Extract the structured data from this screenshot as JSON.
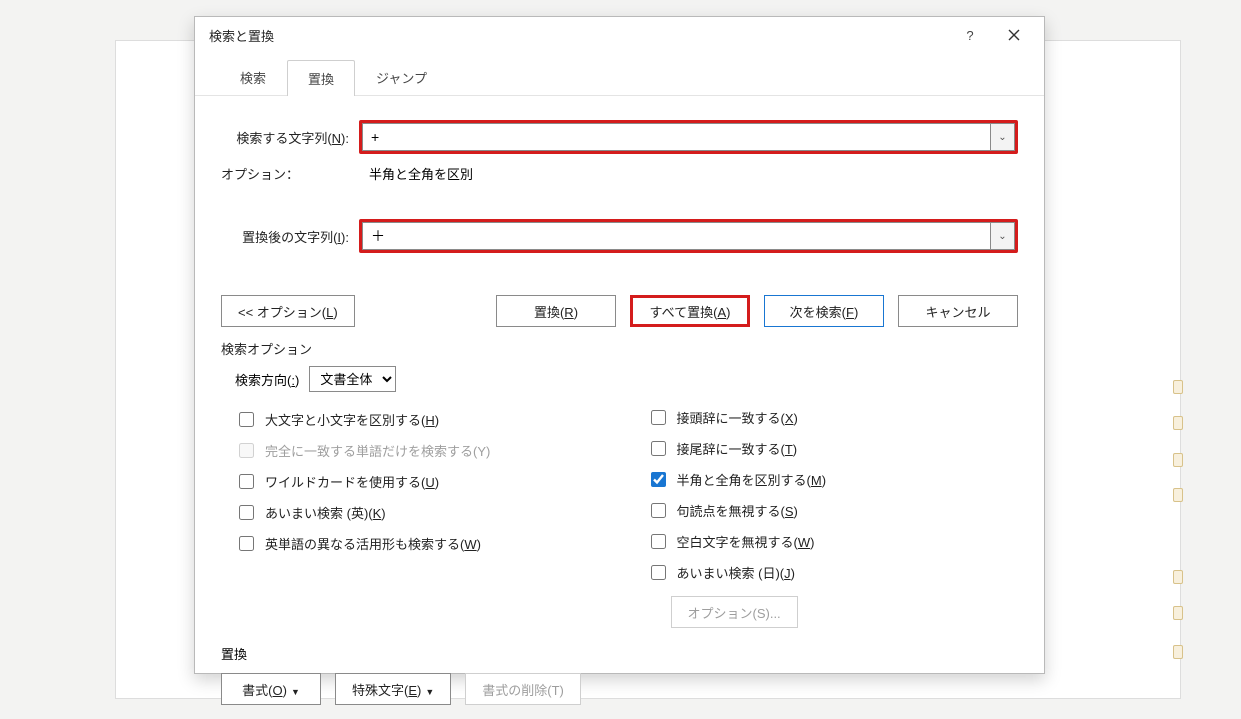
{
  "dialog": {
    "title": "検索と置換",
    "help_label": "?",
    "close_label": "×"
  },
  "tabs": {
    "search": "検索",
    "replace": "置換",
    "jump": "ジャンプ",
    "active": "replace"
  },
  "fields": {
    "find": {
      "label": "検索する文字列(",
      "accel": "N",
      "label_suffix": "):",
      "value": "+",
      "dropdown": "⌄"
    },
    "option_note_label": "オプション：",
    "option_note_value": "半角と全角を区別",
    "replace": {
      "label": "置換後の文字列(",
      "accel": "I",
      "label_suffix": "):",
      "value": "＋",
      "dropdown": "⌄"
    }
  },
  "buttons": {
    "less_options": "<< オプション(",
    "less_options_accel": "L",
    "less_options_suffix": ")",
    "replace": "置換(",
    "replace_accel": "R",
    "replace_suffix": ")",
    "replace_all": "すべて置換(",
    "replace_all_accel": "A",
    "replace_all_suffix": ")",
    "find_next": "次を検索(",
    "find_next_accel": "F",
    "find_next_suffix": ")",
    "cancel": "キャンセル"
  },
  "search_options": {
    "title": "検索オプション",
    "direction_label": "検索方向(",
    "direction_accel": ":",
    "direction_suffix": ")",
    "direction_value": "文書全体",
    "left": {
      "match_case": {
        "label": "大文字と小文字を区別する(",
        "accel": "H",
        "suffix": ")",
        "checked": false,
        "disabled": false
      },
      "whole_word": {
        "label": "完全に一致する単語だけを検索する(Y)",
        "checked": false,
        "disabled": true
      },
      "wildcard": {
        "label": "ワイルドカードを使用する(",
        "accel": "U",
        "suffix": ")",
        "checked": false,
        "disabled": false
      },
      "fuzzy_en": {
        "label": "あいまい検索 (英)(",
        "accel": "K",
        "suffix": ")",
        "checked": false,
        "disabled": false
      },
      "word_forms": {
        "label": "英単語の異なる活用形も検索する(",
        "accel": "W",
        "suffix": ")",
        "checked": false,
        "disabled": false
      }
    },
    "right": {
      "match_prefix": {
        "label": "接頭辞に一致する(",
        "accel": "X",
        "suffix": ")",
        "checked": false,
        "disabled": false
      },
      "match_suffix": {
        "label": "接尾辞に一致する(",
        "accel": "T",
        "suffix": ")",
        "checked": false,
        "disabled": false
      },
      "match_width": {
        "label": "半角と全角を区別する(",
        "accel": "M",
        "suffix": ")",
        "checked": true,
        "disabled": false
      },
      "ignore_punct": {
        "label": "句読点を無視する(",
        "accel": "S",
        "suffix": ")",
        "checked": false,
        "disabled": false
      },
      "ignore_space": {
        "label": "空白文字を無視する(",
        "accel": "W",
        "suffix": ")",
        "checked": false,
        "disabled": false
      },
      "fuzzy_ja": {
        "label": "あいまい検索 (日)(",
        "accel": "J",
        "suffix": ")",
        "checked": false,
        "disabled": false
      },
      "options_btn": {
        "label": "オプション(S)...",
        "disabled": true
      }
    }
  },
  "footer": {
    "title": "置換",
    "format": {
      "label": "書式(",
      "accel": "O",
      "suffix": ")"
    },
    "special": {
      "label": "特殊文字(",
      "accel": "E",
      "suffix": ")"
    },
    "clear_fmt": {
      "label": "書式の削除(T)",
      "disabled": true
    }
  }
}
